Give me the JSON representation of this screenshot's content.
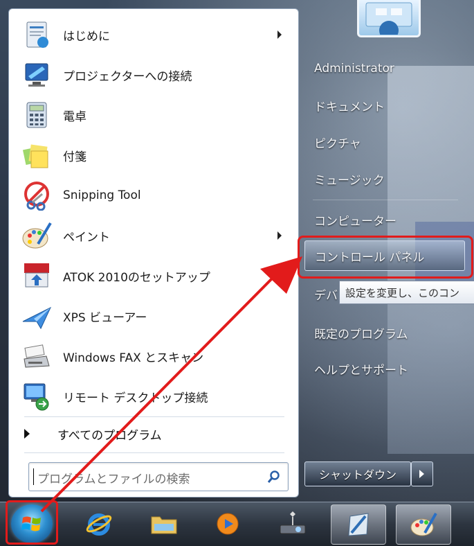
{
  "left_pane": {
    "programs": [
      {
        "label": "はじめに",
        "icon": "getting-started-icon",
        "submenu": true
      },
      {
        "label": "プロジェクターへの接続",
        "icon": "projector-icon",
        "submenu": false
      },
      {
        "label": "電卓",
        "icon": "calculator-icon",
        "submenu": false
      },
      {
        "label": "付箋",
        "icon": "sticky-notes-icon",
        "submenu": false
      },
      {
        "label": "Snipping Tool",
        "icon": "snipping-tool-icon",
        "submenu": false
      },
      {
        "label": "ペイント",
        "icon": "paint-icon",
        "submenu": true
      },
      {
        "label": "ATOK 2010のセットアップ",
        "icon": "atok-setup-icon",
        "submenu": false
      },
      {
        "label": "XPS ビューアー",
        "icon": "xps-viewer-icon",
        "submenu": false
      },
      {
        "label": "Windows FAX とスキャン",
        "icon": "fax-scan-icon",
        "submenu": false
      },
      {
        "label": "リモート デスクトップ接続",
        "icon": "remote-desktop-icon",
        "submenu": false
      }
    ],
    "all_programs": "すべてのプログラム",
    "search_placeholder": "プログラムとファイルの検索"
  },
  "right_pane": {
    "items": [
      "Administrator",
      "ドキュメント",
      "ピクチャ",
      "ミュージック",
      "コンピューター",
      "コントロール パネル",
      "デバ",
      "既定のプログラム",
      "ヘルプとサポート"
    ],
    "highlighted_index": 5,
    "tooltip": "設定を変更し、このコン",
    "shutdown_label": "シャットダウン"
  },
  "taskbar": {
    "buttons": [
      "internet-explorer-icon",
      "explorer-folder-icon",
      "media-player-icon",
      "network-projector-icon",
      "notes-app-icon",
      "paint-app-icon"
    ]
  },
  "colors": {
    "annotation": "#e21b1b",
    "accent": "#2d8fd0"
  }
}
